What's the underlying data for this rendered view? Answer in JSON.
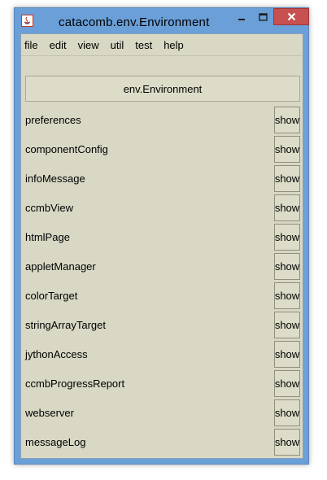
{
  "window": {
    "title": "catacomb.env.Environment"
  },
  "menu": [
    "file",
    "edit",
    "view",
    "util",
    "test",
    "help"
  ],
  "header_button": "env.Environment",
  "show_label": "show",
  "rows": [
    "preferences",
    "componentConfig",
    "infoMessage",
    "ccmbView",
    "htmlPage",
    "appletManager",
    "colorTarget",
    "stringArrayTarget",
    "jythonAccess",
    "ccmbProgressReport",
    "webserver",
    "messageLog"
  ],
  "colors": {
    "title_bar": "#6a9fd8",
    "client_bg": "#d8d8c5",
    "close_button": "#c75050"
  }
}
